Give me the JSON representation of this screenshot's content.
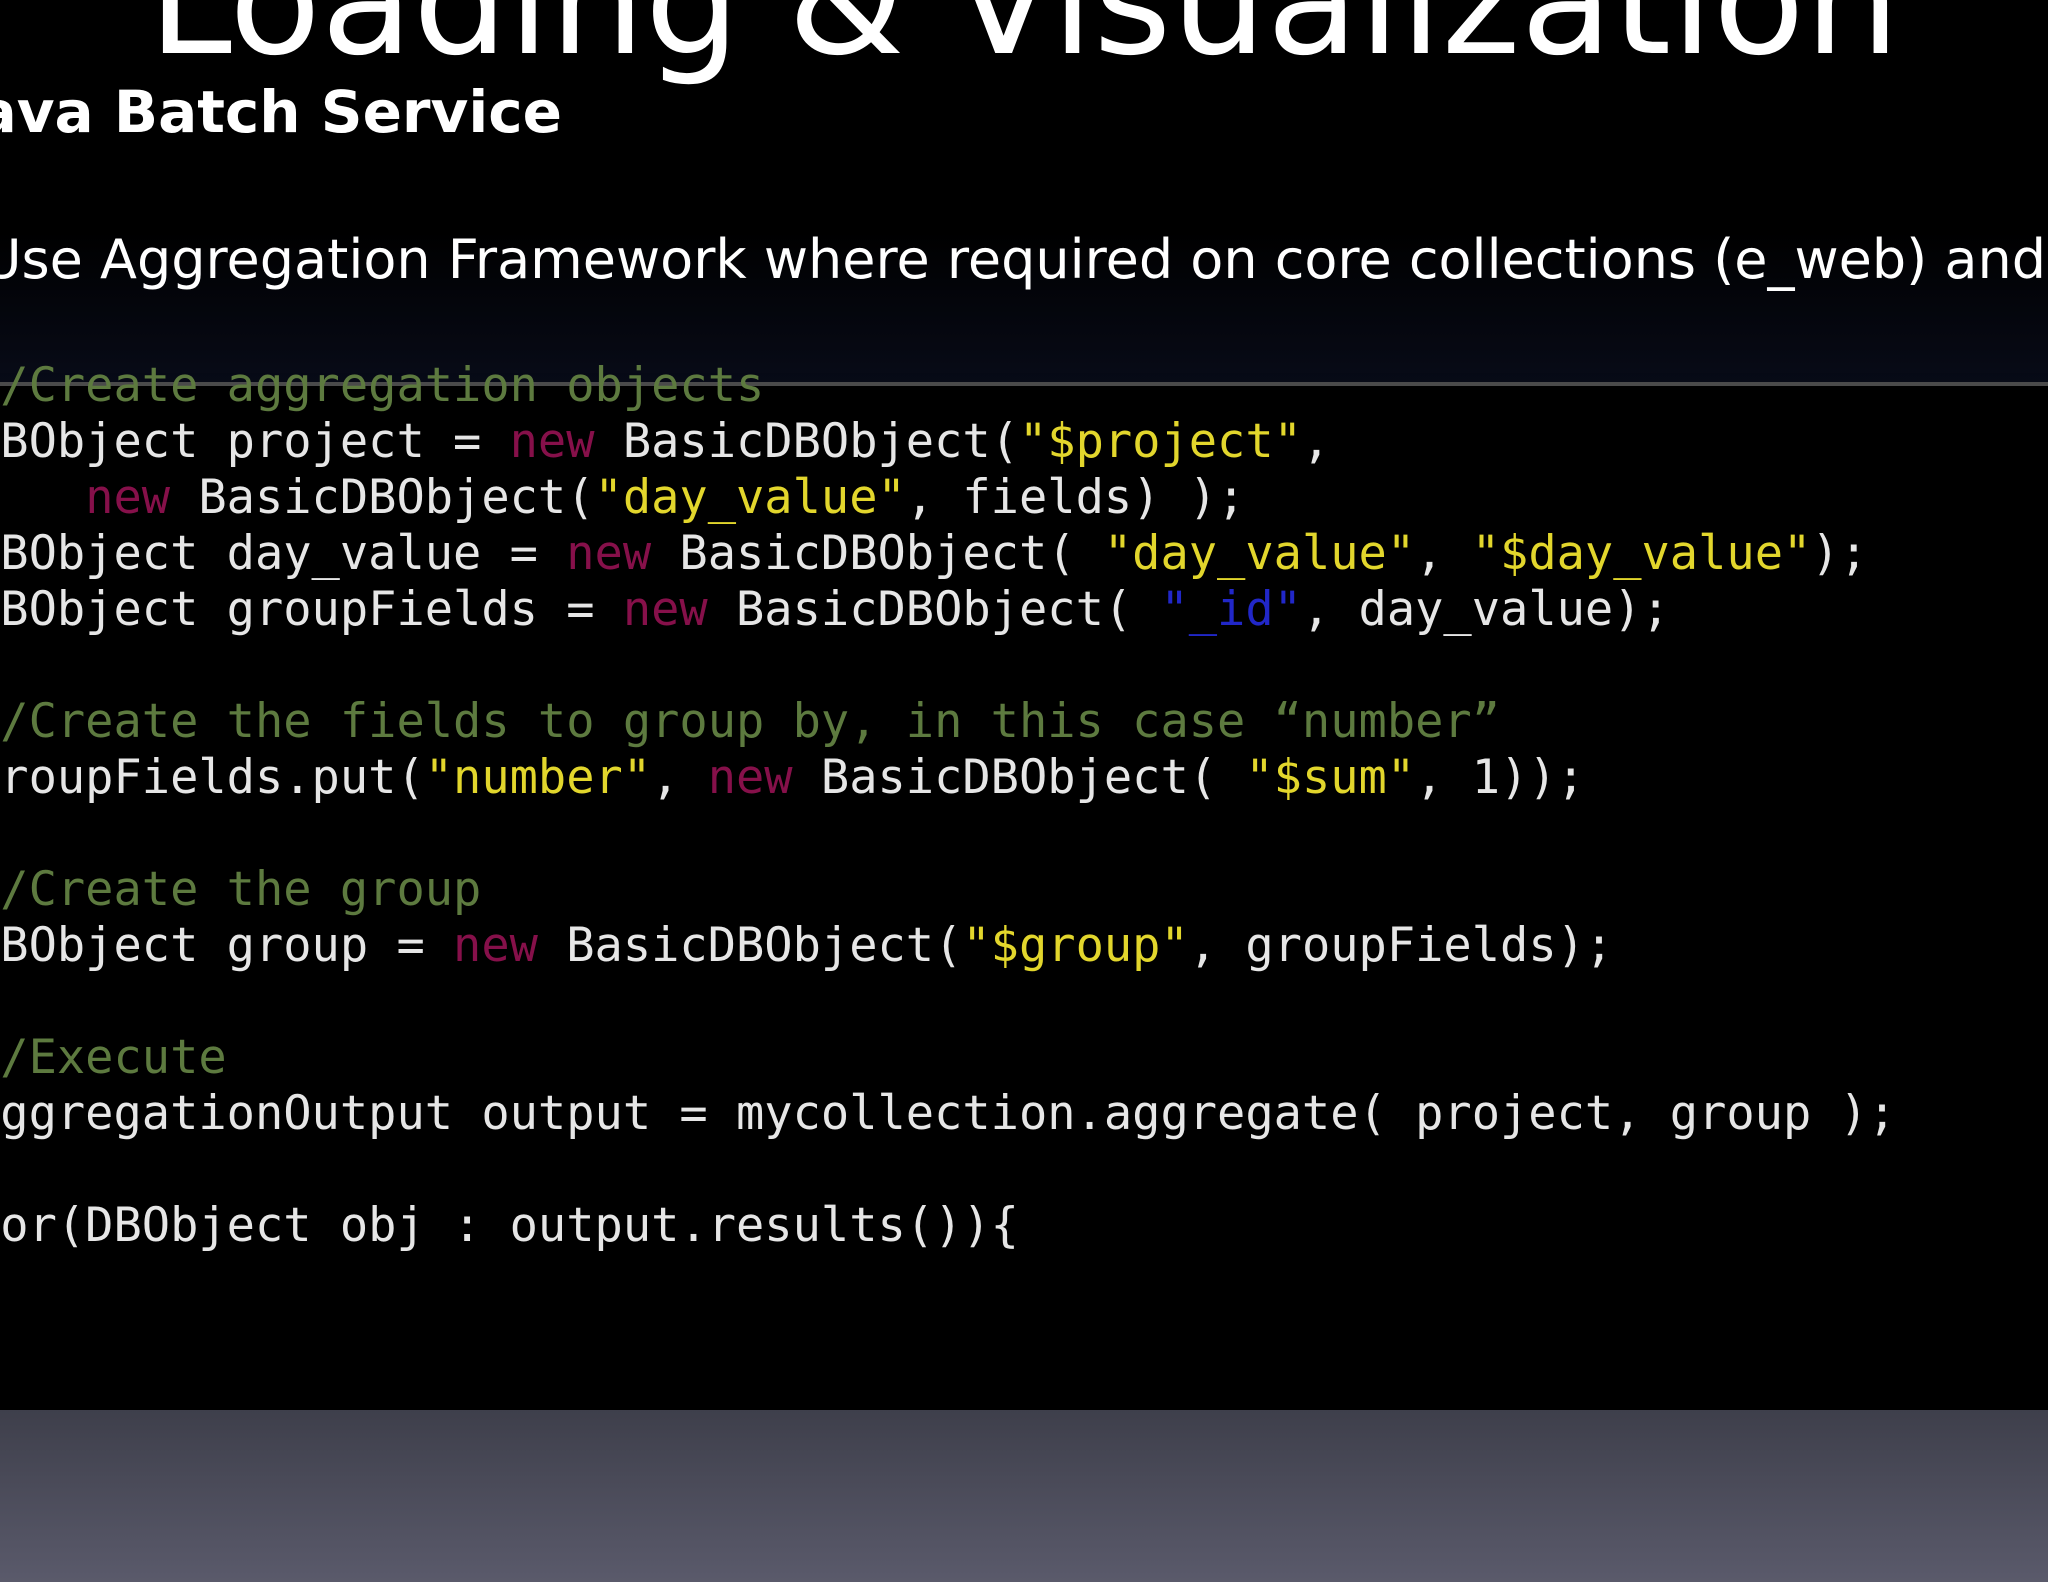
{
  "slide": {
    "title": "Loading & Visualization",
    "subtitle": "Java Batch Service",
    "bullet": "Use Aggregation Framework where required on core collections (e_web) and external"
  },
  "code": {
    "lines": [
      {
        "segments": [
          {
            "t": "//Create aggregation objects",
            "c": "cm"
          }
        ]
      },
      {
        "segments": [
          {
            "t": "DBObject project = ",
            "c": "pl"
          },
          {
            "t": "new",
            "c": "kw"
          },
          {
            "t": " BasicDBObject(",
            "c": "pl"
          },
          {
            "t": "\"$project\"",
            "c": "st"
          },
          {
            "t": ",",
            "c": "pl"
          }
        ]
      },
      {
        "segments": [
          {
            "t": "    ",
            "c": "pl"
          },
          {
            "t": "new",
            "c": "kw"
          },
          {
            "t": " BasicDBObject(",
            "c": "pl"
          },
          {
            "t": "\"day_value\"",
            "c": "st"
          },
          {
            "t": ", fields) );",
            "c": "pl"
          }
        ]
      },
      {
        "segments": [
          {
            "t": "DBObject day_value = ",
            "c": "pl"
          },
          {
            "t": "new",
            "c": "kw"
          },
          {
            "t": " BasicDBObject( ",
            "c": "pl"
          },
          {
            "t": "\"day_value\"",
            "c": "st"
          },
          {
            "t": ", ",
            "c": "pl"
          },
          {
            "t": "\"$day_value\"",
            "c": "st"
          },
          {
            "t": ");",
            "c": "pl"
          }
        ]
      },
      {
        "segments": [
          {
            "t": "DBObject groupFields = ",
            "c": "pl"
          },
          {
            "t": "new",
            "c": "kw"
          },
          {
            "t": " BasicDBObject( ",
            "c": "pl"
          },
          {
            "t": "\"_id\"",
            "c": "sb"
          },
          {
            "t": ", day_value);",
            "c": "pl"
          }
        ]
      },
      {
        "segments": [
          {
            "t": "",
            "c": "pl"
          }
        ]
      },
      {
        "segments": [
          {
            "t": "//Create the fields to group by, in this case “number”",
            "c": "cm"
          }
        ]
      },
      {
        "segments": [
          {
            "t": "groupFields.put(",
            "c": "pl"
          },
          {
            "t": "\"number\"",
            "c": "st"
          },
          {
            "t": ", ",
            "c": "pl"
          },
          {
            "t": "new",
            "c": "kw"
          },
          {
            "t": " BasicDBObject( ",
            "c": "pl"
          },
          {
            "t": "\"$sum\"",
            "c": "st"
          },
          {
            "t": ", 1));",
            "c": "pl"
          }
        ]
      },
      {
        "segments": [
          {
            "t": "",
            "c": "pl"
          }
        ]
      },
      {
        "segments": [
          {
            "t": "//Create the group",
            "c": "cm"
          }
        ]
      },
      {
        "segments": [
          {
            "t": "DBObject group = ",
            "c": "pl"
          },
          {
            "t": "new",
            "c": "kw"
          },
          {
            "t": " BasicDBObject(",
            "c": "pl"
          },
          {
            "t": "\"$group\"",
            "c": "st"
          },
          {
            "t": ", groupFields);",
            "c": "pl"
          }
        ]
      },
      {
        "segments": [
          {
            "t": "",
            "c": "pl"
          }
        ]
      },
      {
        "segments": [
          {
            "t": "//Execute",
            "c": "cm"
          }
        ]
      },
      {
        "segments": [
          {
            "t": "AggregationOutput output = mycollection.aggregate( project, group );",
            "c": "pl"
          }
        ]
      },
      {
        "segments": [
          {
            "t": "",
            "c": "pl"
          }
        ]
      },
      {
        "segments": [
          {
            "t": "for(DBObject obj : output.results()){",
            "c": "pl"
          }
        ]
      }
    ]
  },
  "colors": {
    "comment": "#5d7a3f",
    "keyword": "#86104a",
    "string": "#e2d62c",
    "id_string": "#2127c8",
    "plain": "#e6e6e6",
    "background": "#000000",
    "bottom_gradient": "#4a4b5a"
  }
}
